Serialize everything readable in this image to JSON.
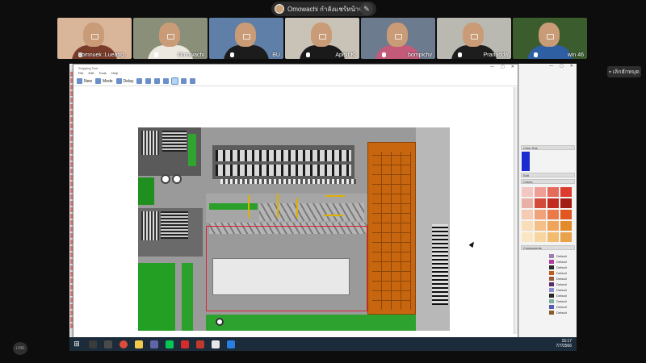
{
  "presenter": {
    "label": "Omowachi กำลังแชร์หน้าจอ",
    "avatar_icon": "avatar",
    "edit_icon": "pencil-icon"
  },
  "participants": [
    {
      "name": "Somnuek :Lueang...",
      "bg": "#d9b59a",
      "shirt": "#7a3b2a"
    },
    {
      "name": "Omowachi",
      "bg": "#8a8f7a",
      "shirt": "#ece7df"
    },
    {
      "name": "BU",
      "bg": "#5f7fa8",
      "shirt": "#1c1c1c"
    },
    {
      "name": "Apisit K.",
      "bg": "#c9c2b6",
      "shirt": "#1a1a1a"
    },
    {
      "name": "bompichy",
      "bg": "#6d7b8f",
      "shirt": "#c45a7a"
    },
    {
      "name": "Pranadda",
      "bg": "#b9b9b2",
      "shirt": "#1d1d1d"
    },
    {
      "name": "win 46",
      "bg": "#3b5d2e",
      "shirt": "#2f5fa3"
    }
  ],
  "leave_button": {
    "label": "เลิกฮักหมุด"
  },
  "snipping_tool": {
    "title": "Snipping Tool",
    "menu": [
      "File",
      "Edit",
      "Tools",
      "Help"
    ],
    "toolbar": {
      "new_label": "New",
      "mode_label": "Mode",
      "delay_label": "Delay"
    }
  },
  "sketchup_tray": {
    "color_header": "Color Sds",
    "edit_label": "Edit",
    "colors_label": "Colors",
    "materials_header": "Components",
    "swatches": [
      "#f2c6c1",
      "#ef9e95",
      "#e56b5d",
      "#dc3b2f",
      "#e8b0a6",
      "#d24a3a",
      "#c12a1e",
      "#a21d14",
      "#f6cbb3",
      "#f2a27b",
      "#ea7a48",
      "#e0571f",
      "#f9ddb8",
      "#f5c087",
      "#efa45a",
      "#e38a2a",
      "#fbe6c4",
      "#f8d49f",
      "#f2bb6e",
      "#e9a24a"
    ],
    "materials": [
      {
        "name": "Default",
        "color": "#9a7fb0"
      },
      {
        "name": "Default",
        "color": "#b03aa0"
      },
      {
        "name": "Default",
        "color": "#2a2a2a"
      },
      {
        "name": "Default",
        "color": "#c05a18"
      },
      {
        "name": "Default",
        "color": "#9a5a3a"
      },
      {
        "name": "Default",
        "color": "#5a2a6a"
      },
      {
        "name": "Default",
        "color": "#8a8fd0"
      },
      {
        "name": "Default",
        "color": "#2a2a2a"
      },
      {
        "name": "Default",
        "color": "#7ab0a0"
      },
      {
        "name": "Default",
        "color": "#5a5ab0"
      },
      {
        "name": "Default",
        "color": "#8a5a2a"
      }
    ]
  },
  "taskbar": {
    "time": "15:17",
    "date": "7/7/2566",
    "start_icon": "windows-icon"
  },
  "line_logo": "LINE"
}
